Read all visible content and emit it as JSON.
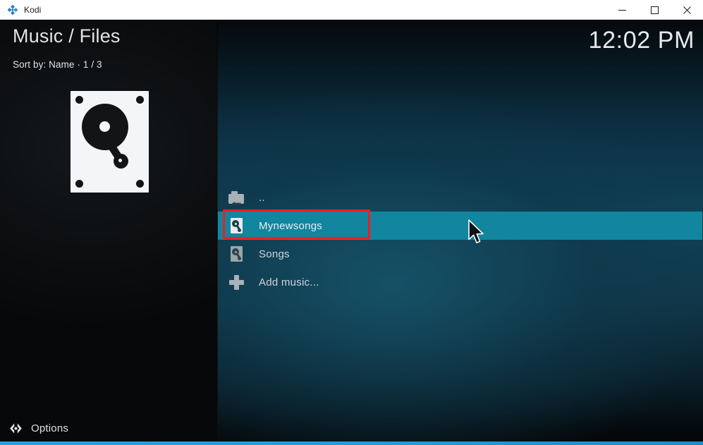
{
  "window": {
    "app_name": "Kodi",
    "logo_icon": "kodi-logo-icon",
    "controls": {
      "minimize_label": "Minimize",
      "maximize_label": "Maximize",
      "close_label": "Close"
    }
  },
  "sidebar": {
    "page_title": "Music / Files",
    "subtitle": "Sort by: Name  ·  1 / 3",
    "thumbnail_icon": "hard-drive-icon",
    "options": {
      "label": "Options",
      "icon": "options-chevrons-icon"
    }
  },
  "main": {
    "clock": "12:02 PM",
    "items": [
      {
        "label": "..",
        "icon": "parent-folder-icon",
        "selected": false
      },
      {
        "label": "Mynewsongs",
        "icon": "hard-drive-icon",
        "selected": true
      },
      {
        "label": "Songs",
        "icon": "hard-drive-icon",
        "selected": false
      },
      {
        "label": "Add music...",
        "icon": "plus-icon",
        "selected": false
      }
    ]
  },
  "colors": {
    "selection": "#12859f",
    "accent_bar": "#1fa3e0",
    "annotation": "#f01c23",
    "panel_teal": "#114157",
    "sidebar": "#0a0c0e"
  },
  "annotation": {
    "target": "Mynewsongs",
    "shape": "rectangle"
  }
}
